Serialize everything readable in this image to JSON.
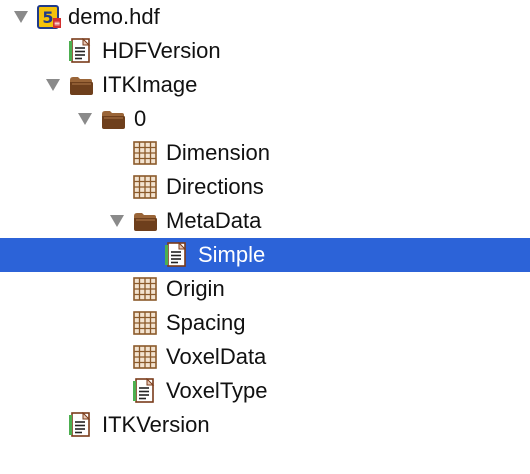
{
  "tree": {
    "root": {
      "label": "demo.hdf",
      "icon": "hdf5-file-icon"
    },
    "hdf_version": {
      "label": "HDFVersion",
      "icon": "text-document-icon"
    },
    "itk_image": {
      "label": "ITKImage",
      "icon": "folder-icon"
    },
    "group_0": {
      "label": "0",
      "icon": "folder-icon"
    },
    "dimension": {
      "label": "Dimension",
      "icon": "dataset-grid-icon"
    },
    "directions": {
      "label": "Directions",
      "icon": "dataset-grid-icon"
    },
    "metadata": {
      "label": "MetaData",
      "icon": "folder-icon"
    },
    "simple": {
      "label": "Simple",
      "icon": "text-document-icon",
      "selected": true
    },
    "origin": {
      "label": "Origin",
      "icon": "dataset-grid-icon"
    },
    "spacing": {
      "label": "Spacing",
      "icon": "dataset-grid-icon"
    },
    "voxel_data": {
      "label": "VoxelData",
      "icon": "dataset-grid-icon"
    },
    "voxel_type": {
      "label": "VoxelType",
      "icon": "text-document-icon"
    },
    "itk_version": {
      "label": "ITKVersion",
      "icon": "text-document-icon"
    }
  },
  "colors": {
    "selection": "#2c63d8",
    "folder": "#7b4a25",
    "grid": "#8b5a2b",
    "disclosure_arrow": "#8a8a8a"
  }
}
